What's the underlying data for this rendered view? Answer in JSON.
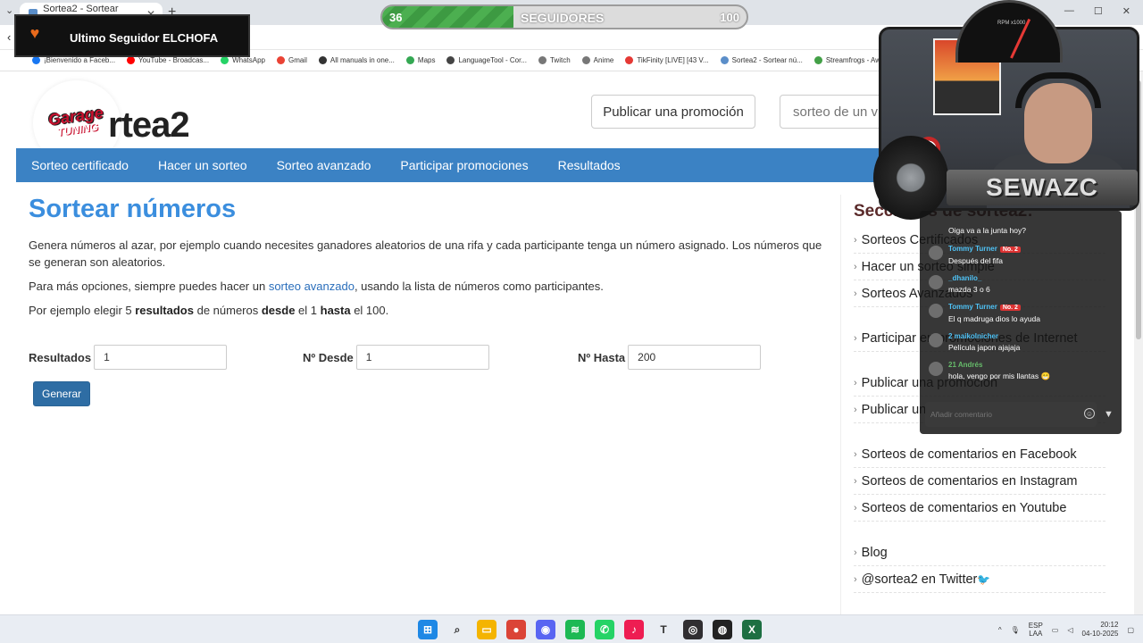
{
  "browser": {
    "tab_title": "Sortea2 - Sortear números",
    "bookmarks": [
      {
        "label": "¡Bienvenido a Faceb...",
        "color": "#1877f2"
      },
      {
        "label": "YouTube - Broadcas...",
        "color": "#ff0000"
      },
      {
        "label": "WhatsApp",
        "color": "#25d366"
      },
      {
        "label": "Gmail",
        "color": "#ea4335"
      },
      {
        "label": "All manuals in one...",
        "color": "#333333"
      },
      {
        "label": "Maps",
        "color": "#34a853"
      },
      {
        "label": "LanguageTool - Cor...",
        "color": "#444444"
      },
      {
        "label": "Twitch",
        "color": "#777777"
      },
      {
        "label": "Anime",
        "color": "#777777"
      },
      {
        "label": "TikFinity [LIVE] [43 V...",
        "color": "#e53935"
      },
      {
        "label": "Sortea2 - Sortear nú...",
        "color": "#5b8ec9"
      },
      {
        "label": "Streamfrogs - Aw...",
        "color": "#43a047"
      }
    ]
  },
  "site": {
    "logo_text": "rtea2",
    "logo_badge_top": "Garage",
    "logo_badge_bottom": "TUNING",
    "publish_button": "Publicar una promoción",
    "search_placeholder": "sorteo de un vi",
    "nav": [
      "Sorteo certificado",
      "Hacer un sorteo",
      "Sorteo avanzado",
      "Participar promociones",
      "Resultados"
    ]
  },
  "main": {
    "title": "Sortear números",
    "intro": "Genera números al azar, por ejemplo cuando necesites ganadores aleatorios de una rifa y cada participante tenga un número asignado. Los números que se generan son aleatorios.",
    "options_before": "Para más opciones, siempre puedes hacer un ",
    "options_link": "sorteo avanzado",
    "options_after": ", usando la lista de números como participantes.",
    "example": {
      "p1": "Por ejemplo elegir 5 ",
      "b1": "resultados",
      "p2": " de números ",
      "b2": "desde",
      "p3": " el 1 ",
      "b3": "hasta",
      "p4": " el 100."
    },
    "form": {
      "resultados_label": "Resultados",
      "resultados_value": "1",
      "desde_label": "Nº Desde",
      "desde_value": "1",
      "hasta_label": "Nº Hasta",
      "hasta_value": "200",
      "submit": "Generar"
    }
  },
  "sidebar": {
    "title": "Secciones de sortea2:",
    "group1": [
      "Sorteos Certificados",
      "Hacer un sorteo simple",
      "Sorteos Avanzados"
    ],
    "group2": [
      "Participar en promociones de Internet"
    ],
    "group3": [
      "Publicar una promoción",
      "Publicar una promoción de Facebook"
    ],
    "group4": [
      "Sorteos de comentarios en Facebook",
      "Sorteos de comentarios en Instagram",
      "Sorteos de comentarios en Youtube"
    ],
    "group5": [
      "Blog",
      "@sortea2 en Twitter"
    ]
  },
  "overlay": {
    "last_follower": "Ultimo Seguidor ELCHOFA",
    "followers_label": "SEGUIDORES",
    "followers_current": "36",
    "followers_goal": "100",
    "followers_progress": 0.36,
    "gauge_unit": "RPM x1000",
    "streamer_name": "SEWAZC"
  },
  "chat": {
    "messages": [
      {
        "user": "",
        "user_color": "#ffffff",
        "badge": "",
        "text": "Oiga va a la junta hoy?",
        "avatar": false
      },
      {
        "user": "Tommy Turner",
        "user_color": "#4fc3f7",
        "badge": "No. 2",
        "text": "Después del fifa",
        "avatar": true
      },
      {
        "user": "_dhanilo_",
        "user_color": "#4fc3f7",
        "badge": "",
        "text": "mazda 3 o 6",
        "avatar": true
      },
      {
        "user": "Tommy Turner",
        "user_color": "#4fc3f7",
        "badge": "No. 2",
        "text": "El q madruga dios lo ayuda",
        "avatar": true
      },
      {
        "user": "2  maikolnicher",
        "user_color": "#4fc3f7",
        "badge": "",
        "text": "Película japon ajajaja",
        "avatar": true
      },
      {
        "user": "21  Andrés",
        "user_color": "#66bb6a",
        "badge": "",
        "text": "hola, vengo por mis llantas 😁",
        "avatar": true
      }
    ],
    "input_placeholder": "Añadir comentario"
  },
  "taskbar": {
    "language": "ESP",
    "language_sub": "LAA",
    "time": "20:12",
    "date": "04-10-2025",
    "apps": [
      {
        "name": "windows-start",
        "color": "#1e88e5",
        "glyph": "⊞"
      },
      {
        "name": "search",
        "color": "#e9edf3",
        "glyph": "⌕"
      },
      {
        "name": "file-explorer",
        "color": "#f4b400",
        "glyph": "▭"
      },
      {
        "name": "chrome",
        "color": "#db4437",
        "glyph": "●"
      },
      {
        "name": "discord",
        "color": "#5865f2",
        "glyph": "◉"
      },
      {
        "name": "spotify",
        "color": "#1db954",
        "glyph": "≋"
      },
      {
        "name": "whatsapp",
        "color": "#25d366",
        "glyph": "✆"
      },
      {
        "name": "tiktok",
        "color": "#ee1d52",
        "glyph": "♪"
      },
      {
        "name": "typora",
        "color": "#e9edf3",
        "glyph": "T"
      },
      {
        "name": "obs",
        "color": "#302e31",
        "glyph": "◎"
      },
      {
        "name": "obs-live",
        "color": "#222222",
        "glyph": "◍"
      },
      {
        "name": "excel",
        "color": "#1d6f42",
        "glyph": "X"
      }
    ]
  }
}
